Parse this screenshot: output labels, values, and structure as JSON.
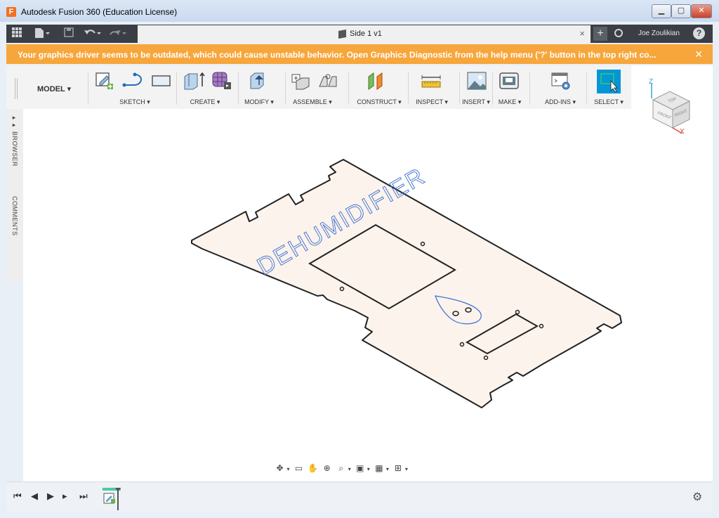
{
  "window": {
    "app_letter": "F",
    "title": "Autodesk Fusion 360 (Education License)",
    "controls": {
      "minimize": "▁",
      "maximize": "▢",
      "close": "✕"
    }
  },
  "toolbar": {
    "doc_name": "Side 1 v1",
    "close_tab": "×",
    "new_tab": "+",
    "user": "Joe Zoulikian",
    "help": "?"
  },
  "warning": {
    "message": "Your graphics driver seems to be outdated, which could cause unstable behavior. Open Graphics Diagnostic from the help menu ('?' button in the top right co...",
    "close": "✕"
  },
  "ribbon": {
    "workspace": "MODEL ▾",
    "groups": {
      "sketch": "SKETCH ▾",
      "create": "CREATE ▾",
      "modify": "MODIFY ▾",
      "assemble": "ASSEMBLE ▾",
      "construct": "CONSTRUCT ▾",
      "inspect": "INSPECT ▾",
      "insert": "INSERT ▾",
      "make": "MAKE ▾",
      "addins": "ADD-INS ▾",
      "select": "SELECT ▾"
    }
  },
  "side": {
    "browser": "▸▸ BROWSER",
    "comments": "COMMENTS"
  },
  "canvas": {
    "engraved_text": "DEHUMIDIFIER"
  },
  "viewcube": {
    "z": "Z",
    "x": "X",
    "top": "TOP",
    "front": "FRONT",
    "right": "RIGHT"
  },
  "colors": {
    "accent": "#0696d7",
    "warning": "#f7a63c",
    "part_fill": "#fbf3ec",
    "sketch_line": "#3a6fd1"
  }
}
